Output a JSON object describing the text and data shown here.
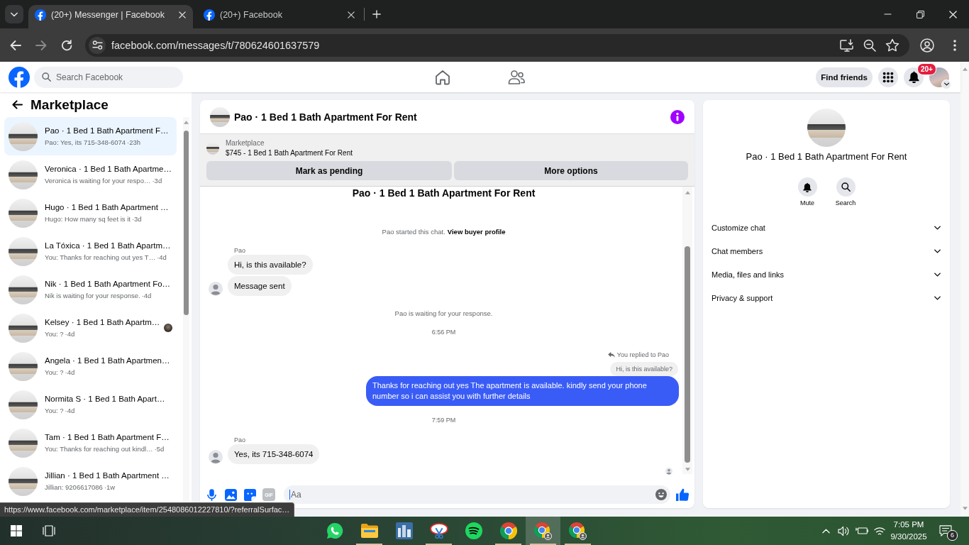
{
  "browser": {
    "tabs": [
      {
        "title": "(20+) Messenger | Facebook",
        "selected": true
      },
      {
        "title": "(20+) Facebook",
        "selected": false
      }
    ],
    "address": "facebook.com/messages/t/780624601637579",
    "status_url": "https://www.facebook.com/marketplace/item/2548086012227810/?referralSurfac…"
  },
  "header": {
    "search": {
      "placeholder": "Search Facebook"
    },
    "find_friends": "Find friends",
    "notification_badge": "20+"
  },
  "sidebar": {
    "title": "Marketplace",
    "conversations": [
      {
        "title": "Pao · 1 Bed 1 Bath Apartment F…",
        "preview": "Pao: Yes, its 715-348-6074",
        "time": "·23h",
        "selected": true,
        "read_receipt": false
      },
      {
        "title": "Veronica · 1 Bed 1 Bath Apartme…",
        "preview": "Veronica is waiting for your respo…",
        "time": "·3d",
        "selected": false,
        "read_receipt": false
      },
      {
        "title": "Hugo · 1 Bed 1 Bath Apartment …",
        "preview": "Hugo: How many sq feet is it",
        "time": "·3d",
        "selected": false,
        "read_receipt": false
      },
      {
        "title": "La Tóxica · 1 Bed 1 Bath Apartm…",
        "preview": "You: Thanks for reaching out yes T…",
        "time": "·4d",
        "selected": false,
        "read_receipt": false
      },
      {
        "title": "Nik · 1 Bed 1 Bath Apartment Fo…",
        "preview": "Nik is waiting for your response.",
        "time": "·4d",
        "selected": false,
        "read_receipt": false
      },
      {
        "title": "Kelsey · 1 Bed 1 Bath Apartm…",
        "preview": "You: ?",
        "time": "·4d",
        "selected": false,
        "read_receipt": true
      },
      {
        "title": "Angela · 1 Bed 1 Bath Apartmen…",
        "preview": "You: ?",
        "time": "·4d",
        "selected": false,
        "read_receipt": false
      },
      {
        "title": "Normita S · 1 Bed 1 Bath Apart…",
        "preview": "You: ?",
        "time": "·4d",
        "selected": false,
        "read_receipt": false
      },
      {
        "title": "Tam · 1 Bed 1 Bath Apartment F…",
        "preview": "You: Thanks for reaching out kindl…",
        "time": "·5d",
        "selected": false,
        "read_receipt": false
      },
      {
        "title": "Jillian · 1 Bed 1 Bath Apartment …",
        "preview": "Jillian: 9206617086",
        "time": "·1w",
        "selected": false,
        "read_receipt": false
      }
    ]
  },
  "chat": {
    "title": "Pao · 1 Bed 1 Bath Apartment For Rent",
    "listing": {
      "label": "Marketplace",
      "title": "$745 - 1 Bed 1 Bath Apartment For Rent"
    },
    "actions": [
      "Mark as pending",
      "More options"
    ],
    "messages": [
      {
        "kind": "heading",
        "text": "Pao · 1 Bed 1 Bath Apartment For Rent"
      },
      {
        "kind": "notice",
        "text": "Pao started this chat.",
        "link": "View buyer profile"
      },
      {
        "kind": "sender",
        "text": "Pao"
      },
      {
        "kind": "incoming",
        "text": "Hi, is this available?",
        "avatar": false
      },
      {
        "kind": "incoming",
        "text": "Message sent",
        "avatar": true
      },
      {
        "kind": "notice",
        "text": "Pao is waiting for your response."
      },
      {
        "kind": "time",
        "text": "6:56 PM"
      },
      {
        "kind": "reply_note",
        "text": "You replied to Pao"
      },
      {
        "kind": "quote",
        "text": "Hi, is this available?"
      },
      {
        "kind": "outgoing",
        "text": "Thanks for reaching out yes The apartment is available. kindly send your phone number so i can assist you with further details"
      },
      {
        "kind": "time",
        "text": "7:59 PM"
      },
      {
        "kind": "sender",
        "text": "Pao"
      },
      {
        "kind": "incoming",
        "text": "Yes, its 715-348-6074",
        "avatar": true
      },
      {
        "kind": "seen"
      }
    ],
    "composer": {
      "gif_label": "GIF",
      "placeholder": "Aa"
    }
  },
  "details": {
    "title": "Pao · 1 Bed 1 Bath Apartment For Rent",
    "actions": [
      {
        "kind": "mute",
        "label": "Mute"
      },
      {
        "kind": "search",
        "label": "Search"
      }
    ],
    "sections": [
      {
        "label": "Customize chat",
        "expanded": false
      },
      {
        "label": "Chat members",
        "expanded": false
      },
      {
        "label": "Media, files and links",
        "expanded": false
      },
      {
        "label": "Privacy & support",
        "expanded": false
      }
    ]
  },
  "taskbar": {
    "apps": [
      {
        "kind": "chat",
        "running": false,
        "selected": false
      },
      {
        "kind": "folder",
        "running": true,
        "selected": false
      },
      {
        "kind": "tile",
        "running": false,
        "selected": false
      },
      {
        "kind": "scissors",
        "running": true,
        "selected": false
      },
      {
        "kind": "waves",
        "running": false,
        "selected": false
      },
      {
        "kind": "browser",
        "running": true,
        "selected": false
      },
      {
        "kind": "browser_profile",
        "running": true,
        "selected": true
      },
      {
        "kind": "browser_profile",
        "running": true,
        "selected": false
      }
    ],
    "time": "7:05 PM",
    "date": "9/30/2025",
    "notifications": "6"
  }
}
